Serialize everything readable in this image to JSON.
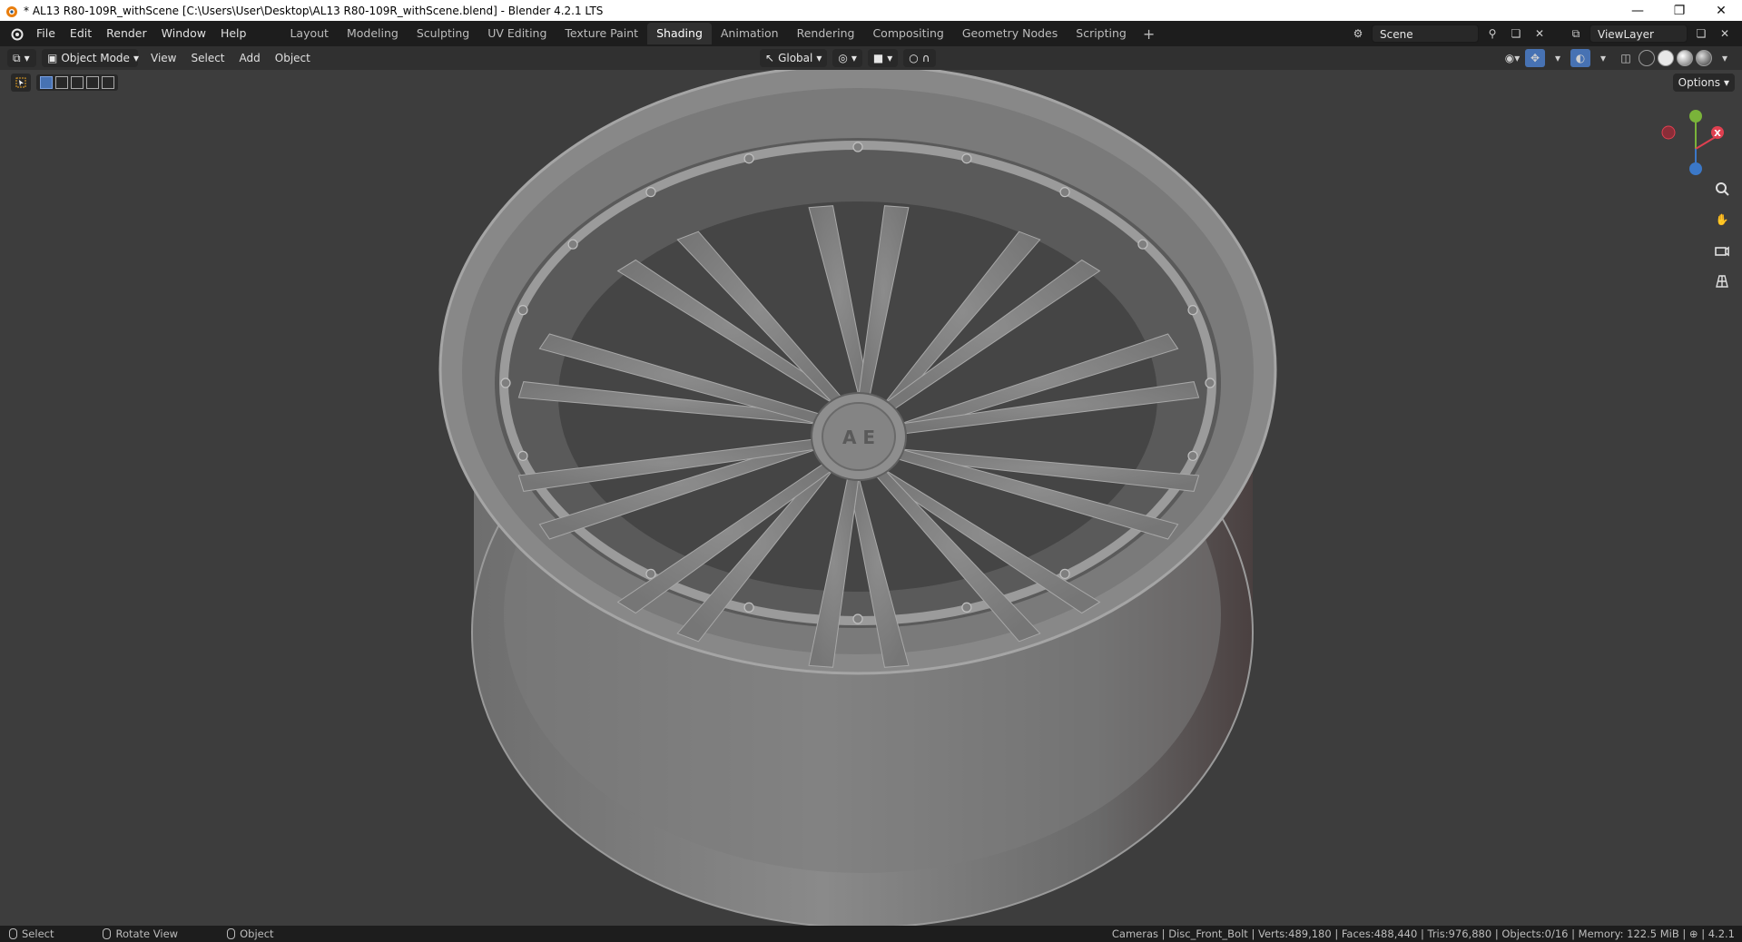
{
  "window": {
    "title": "* AL13 R80-109R_withScene [C:\\Users\\User\\Desktop\\AL13 R80-109R_withScene.blend] - Blender 4.2.1 LTS",
    "controls": [
      "minimize-icon",
      "restore-icon",
      "close-icon"
    ]
  },
  "menu": {
    "items": [
      "File",
      "Edit",
      "Render",
      "Window",
      "Help"
    ]
  },
  "workspaces": {
    "tabs": [
      "Layout",
      "Modeling",
      "Sculpting",
      "UV Editing",
      "Texture Paint",
      "Shading",
      "Animation",
      "Rendering",
      "Compositing",
      "Geometry Nodes",
      "Scripting"
    ],
    "active": "Shading",
    "add_label": "+"
  },
  "scene": {
    "name": "Scene"
  },
  "view_layer": {
    "name": "ViewLayer"
  },
  "viewport_header": {
    "mode": "Object Mode",
    "menus": [
      "View",
      "Select",
      "Add",
      "Object"
    ],
    "orientation": "Global"
  },
  "viewport": {
    "options_label": "Options",
    "gizmo": {
      "x_label": "X",
      "accent_x": "#e04050",
      "accent_y": "#7ab33a",
      "accent_z": "#3b78c8"
    },
    "icons": [
      "zoom-icon",
      "hand-pan-icon",
      "camera-icon",
      "perspective-grid-icon"
    ]
  },
  "status": {
    "left": [
      {
        "label": "Select",
        "icon": "mouse-left-icon"
      },
      {
        "label": "Rotate View",
        "icon": "mouse-middle-icon"
      },
      {
        "label": "Object",
        "icon": "mouse-right-icon"
      }
    ],
    "stats": "Cameras | Disc_Front_Bolt | Verts:489,180 | Faces:488,440 | Tris:976,880 | Objects:0/16 | Memory: 122.5 MiB | ⊕ | 4.2.1"
  },
  "colors": {
    "background": "#3d3d3d",
    "topbar": "#1d1d1d",
    "header": "#303030",
    "accent": "#4772b3"
  }
}
